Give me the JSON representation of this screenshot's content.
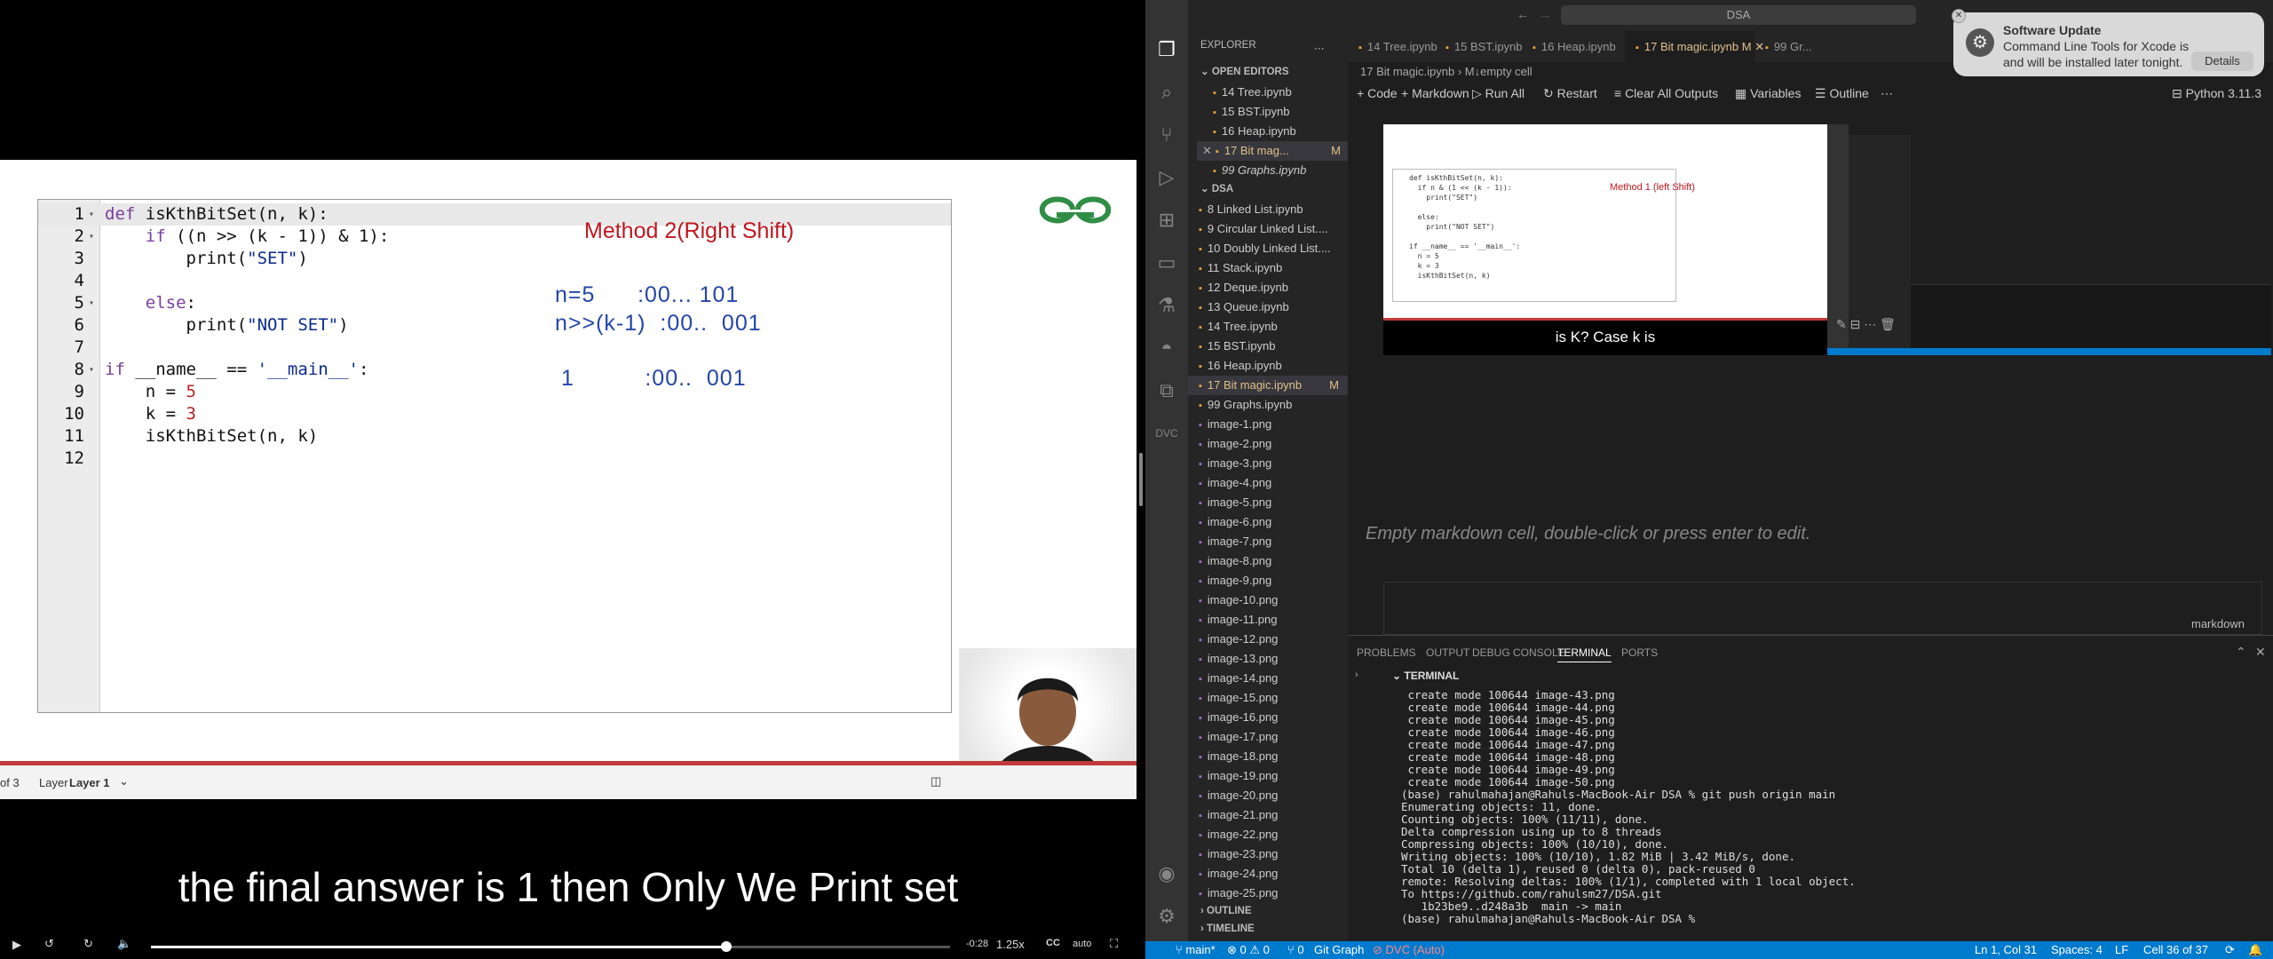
{
  "video": {
    "code_lines": [
      {
        "n": "1",
        "fold": "▾",
        "parts": [
          [
            "kw",
            "def"
          ],
          [
            "t",
            " isKthBitSet(n, k):"
          ]
        ],
        "hl": true
      },
      {
        "n": "2",
        "fold": "▾",
        "parts": [
          [
            "t",
            "    "
          ],
          [
            "kw",
            "if"
          ],
          [
            "t",
            " ((n >> (k - 1)) & 1):"
          ]
        ]
      },
      {
        "n": "3",
        "fold": "",
        "parts": [
          [
            "t",
            "        print("
          ],
          [
            "str",
            "\"SET\""
          ],
          [
            "t",
            ")"
          ]
        ]
      },
      {
        "n": "4",
        "fold": "",
        "parts": [
          [
            "t",
            ""
          ]
        ]
      },
      {
        "n": "5",
        "fold": "▾",
        "parts": [
          [
            "t",
            "    "
          ],
          [
            "kw",
            "else"
          ],
          [
            "t",
            ":"
          ]
        ]
      },
      {
        "n": "6",
        "fold": "",
        "parts": [
          [
            "t",
            "        print("
          ],
          [
            "str",
            "\"NOT SET\""
          ],
          [
            "t",
            ")"
          ]
        ]
      },
      {
        "n": "7",
        "fold": "",
        "parts": [
          [
            "t",
            ""
          ]
        ]
      },
      {
        "n": "8",
        "fold": "▾",
        "parts": [
          [
            "kw",
            "if"
          ],
          [
            "t",
            " __name__ == "
          ],
          [
            "str",
            "'__main__'"
          ],
          [
            "t",
            ":"
          ]
        ]
      },
      {
        "n": "9",
        "fold": "",
        "parts": [
          [
            "t",
            "    n = "
          ],
          [
            "num",
            "5"
          ]
        ]
      },
      {
        "n": "10",
        "fold": "",
        "parts": [
          [
            "t",
            "    k = "
          ],
          [
            "num",
            "3"
          ]
        ]
      },
      {
        "n": "11",
        "fold": "",
        "parts": [
          [
            "t",
            "    isKthBitSet(n, k)"
          ]
        ]
      },
      {
        "n": "12",
        "fold": "",
        "parts": [
          [
            "t",
            ""
          ]
        ]
      }
    ],
    "method_title": "Method 2(Right Shift)",
    "hw1": "n=5      :00... 101",
    "hw2": "n>>(k-1)  :00..  001",
    "hw3": "1          :00..  001",
    "page_of": "of 3",
    "layer_label": "Layer",
    "layer_value": "Layer 1",
    "subtitle": "the final answer is 1 then Only We Print set",
    "time_remaining": "-0:28",
    "speed": "1.25x",
    "quality": "auto",
    "progress": 0.72
  },
  "vscode": {
    "search": "DSA",
    "explorer": "EXPLORER",
    "open_editors": "OPEN EDITORS",
    "open_files": [
      "14 Tree.ipynb",
      "15 BST.ipynb",
      "16 Heap.ipynb",
      "17 Bit mag...",
      "99 Graphs.ipynb"
    ],
    "modified": "M",
    "folder": "DSA",
    "files": [
      "8 Linked List.ipynb",
      "9 Circular Linked List....",
      "10 Doubly Linked List....",
      "11 Stack.ipynb",
      "12 Deque.ipynb",
      "13 Queue.ipynb",
      "14 Tree.ipynb",
      "15 BST.ipynb",
      "16 Heap.ipynb",
      "17 Bit magic.ipynb",
      "99 Graphs.ipynb",
      "image-1.png",
      "image-2.png",
      "image-3.png",
      "image-4.png",
      "image-5.png",
      "image-6.png",
      "image-7.png",
      "image-8.png",
      "image-9.png",
      "image-10.png",
      "image-11.png",
      "image-12.png",
      "image-13.png",
      "image-14.png",
      "image-15.png",
      "image-16.png",
      "image-17.png",
      "image-18.png",
      "image-19.png",
      "image-20.png",
      "image-21.png",
      "image-22.png",
      "image-23.png",
      "image-24.png",
      "image-25.png"
    ],
    "outline": "OUTLINE",
    "timeline": "TIMELINE",
    "tabs": [
      "14 Tree.ipynb",
      "15 BST.ipynb",
      "16 Heap.ipynb",
      "17 Bit magic.ipynb",
      "99 Gr..."
    ],
    "breadcrumb": "17 Bit magic.ipynb  ›  M↓empty cell",
    "toolbar": {
      "code": "Code",
      "markdown": "Markdown",
      "run_all": "Run All",
      "restart": "Restart",
      "clear": "Clear All Outputs",
      "variables": "Variables",
      "outline": "Outline",
      "kernel": "Python 3.11.3"
    },
    "inner_caption": "is K? Case k is",
    "inner_method": "Method 1 (left Shift)",
    "empty_md": "Empty markdown cell, double-click or press enter to edit.",
    "cell_lang": "markdown",
    "panel_tabs": [
      "PROBLEMS",
      "OUTPUT",
      "DEBUG CONSOLE",
      "TERMINAL",
      "PORTS"
    ],
    "terminal": "TERMINAL",
    "terminal_lines": [
      " create mode 100644 image-43.png",
      " create mode 100644 image-44.png",
      " create mode 100644 image-45.png",
      " create mode 100644 image-46.png",
      " create mode 100644 image-47.png",
      " create mode 100644 image-48.png",
      " create mode 100644 image-49.png",
      " create mode 100644 image-50.png",
      "(base) rahulmahajan@Rahuls-MacBook-Air DSA % git push origin main",
      "Enumerating objects: 11, done.",
      "Counting objects: 100% (11/11), done.",
      "Delta compression using up to 8 threads",
      "Compressing objects: 100% (10/10), done.",
      "Writing objects: 100% (10/10), 1.82 MiB | 3.42 MiB/s, done.",
      "Total 10 (delta 1), reused 0 (delta 0), pack-reused 0",
      "remote: Resolving deltas: 100% (1/1), completed with 1 local object.",
      "To https://github.com/rahulsm27/DSA.git",
      "   1b23be9..d248a3b  main -> main",
      "(base) rahulmahajan@Rahuls-MacBook-Air DSA % "
    ],
    "status": {
      "branch": "main*",
      "errors": "⊗ 0 ⚠ 0",
      "ports": "⑂ 0",
      "graph": "Git Graph",
      "dvc": "DVC (Auto)",
      "pos": "Ln 1, Col 31",
      "spaces": "Spaces: 4",
      "eol": "LF",
      "cell": "Cell 36 of 37"
    },
    "notif": {
      "title": "Software Update",
      "body": "Command Line Tools for Xcode is",
      "body2": "and will be installed later tonight.",
      "details": "Details"
    }
  },
  "colors": {
    "accent": "#007acc",
    "modified": "#e2c08d",
    "method_red": "#c0171f",
    "ink_blue": "#2545a8"
  }
}
